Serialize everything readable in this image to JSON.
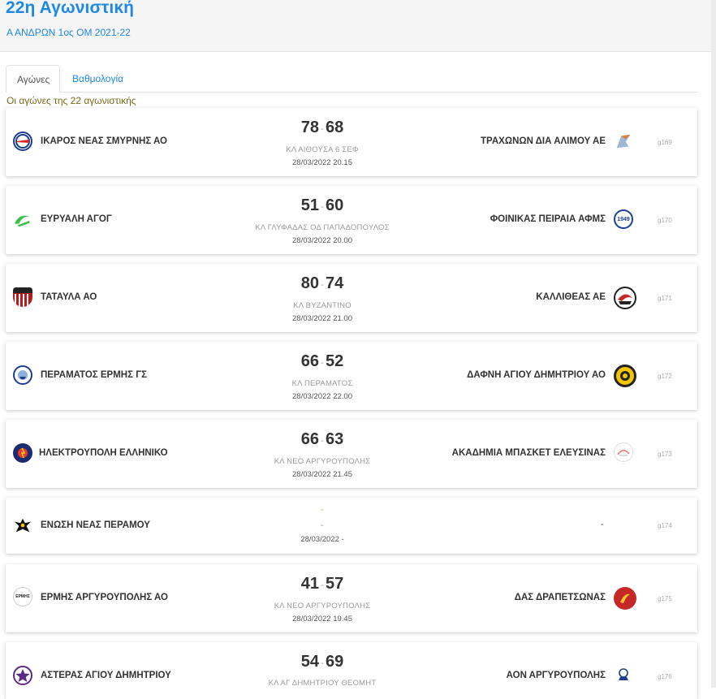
{
  "header": {
    "title": "22η Αγωνιστική",
    "subtitle": "Α ΑΝΔΡΩΝ 1ος ΟΜ 2021-22"
  },
  "tabs": [
    {
      "label": "Αγώνες",
      "active": true
    },
    {
      "label": "Βαθμολογία",
      "active": false
    }
  ],
  "round_note": "Οι αγώνες της 22 αγωνιστικής",
  "colors": {
    "accent": "#1e88e5",
    "note": "#7a6a1a"
  },
  "matches": [
    {
      "home": "ΙΚΑΡΟΣ ΝΕΑΣ ΣΜΥΡΝΗΣ ΑΟ",
      "home_score": "78",
      "sep": "-",
      "away_score": "68",
      "venue": "ΚΛ ΑΙΘΟΥΣΑ 6 ΣΕΦ",
      "datetime": "28/03/2022 20.15",
      "away": "ΤΡΑΧΩΝΩΝ ΔΙΑ ΑΛΙΜΟΥ ΑΕ",
      "code": "g169",
      "home_logo": "ikaros-logo",
      "away_logo": "trachones-logo"
    },
    {
      "home": "ΕΥΡΥΑΛΗ ΑΓΟΓ",
      "home_score": "51",
      "sep": "-",
      "away_score": "60",
      "venue": "ΚΛ ΓΛΥΦΑΔΑΣ ΟΔ ΠΑΠΑΔΟΠΟΥΛΟΣ",
      "datetime": "28/03/2022 20.00",
      "away": "ΦΟΙΝΙΚΑΣ ΠΕΙΡΑΙΑ ΑΦΜΣ",
      "code": "g170",
      "home_logo": "euryali-logo",
      "away_logo": "foinikas-logo",
      "away_logo_text": "1949"
    },
    {
      "home": "ΤΑΤΑΥΛΑ ΑΟ",
      "home_score": "80",
      "sep": "-",
      "away_score": "74",
      "venue": "ΚΛ ΒΥΖΑΝΤΙΝΟ",
      "datetime": "28/03/2022 21.00",
      "away": "ΚΑΛΛΙΘΕΑΣ ΑΕ",
      "code": "g171",
      "home_logo": "tatavla-logo",
      "away_logo": "kallithea-logo"
    },
    {
      "home": "ΠΕΡΑΜΑΤΟΣ ΕΡΜΗΣ ΓΣ",
      "home_score": "66",
      "sep": "-",
      "away_score": "52",
      "venue": "ΚΛ ΠΕΡΑΜΑΤΟΣ",
      "datetime": "28/03/2022 22.00",
      "away": "ΔΑΦΝΗ ΑΓΙΟΥ ΔΗΜΗΤΡΙΟΥ ΑΟ",
      "code": "g172",
      "home_logo": "perama-logo",
      "away_logo": "dafni-logo"
    },
    {
      "home": "ΗΛΕΚΤΡΟΥΠΟΛΗ ΕΛΛΗΝΙΚΟ",
      "home_score": "66",
      "sep": "-",
      "away_score": "63",
      "venue": "ΚΛ ΝΕΟ ΑΡΓΥΡΟΥΠΟΛΗΣ",
      "datetime": "28/03/2022 21.45",
      "away": "ΑΚΑΔΗΜΙΑ ΜΠΑΣΚΕΤ ΕΛΕΥΣΙΝΑΣ",
      "code": "g173",
      "home_logo": "ilektroupoli-logo",
      "away_logo": "elefsina-logo"
    },
    {
      "home": "ΕΝΩΣΗ ΝΕΑΣ ΠΕΡΑΜΟΥ",
      "pending": true,
      "score_dash": "-",
      "venue": "-",
      "datetime": "28/03/2022 -",
      "away": "-",
      "code": "g174",
      "home_logo": "enosi-logo"
    },
    {
      "home": "ΕΡΜΗΣ ΑΡΓΥΡΟΥΠΟΛΗΣ ΑΟ",
      "home_score": "41",
      "sep": "-",
      "away_score": "57",
      "venue": "ΚΛ ΝΕΟ ΑΡΓΥΡΟΥΠΟΛΗΣ",
      "datetime": "28/03/2022 19.45",
      "away": "ΔΑΣ ΔΡΑΠΕΤΣΩΝΑΣ",
      "code": "g175",
      "home_logo": "ermis-logo",
      "home_logo_text": "ΕΡΜΗΣ",
      "away_logo": "drapetsona-logo"
    },
    {
      "home": "ΑΣΤΕΡΑΣ ΑΓΙΟΥ ΔΗΜΗΤΡΙΟΥ",
      "home_score": "54",
      "sep": "-",
      "away_score": "69",
      "venue": "ΚΛ ΑΓ ΔΗΜΗΤΡΙΟΥ ΘΕΟΜΗΤ",
      "datetime": "",
      "away": "ΑΟΝ ΑΡΓΥΡΟΥΠΟΛΗΣ",
      "code": "g176",
      "home_logo": "asteras-logo",
      "away_logo": "aon-logo"
    }
  ]
}
